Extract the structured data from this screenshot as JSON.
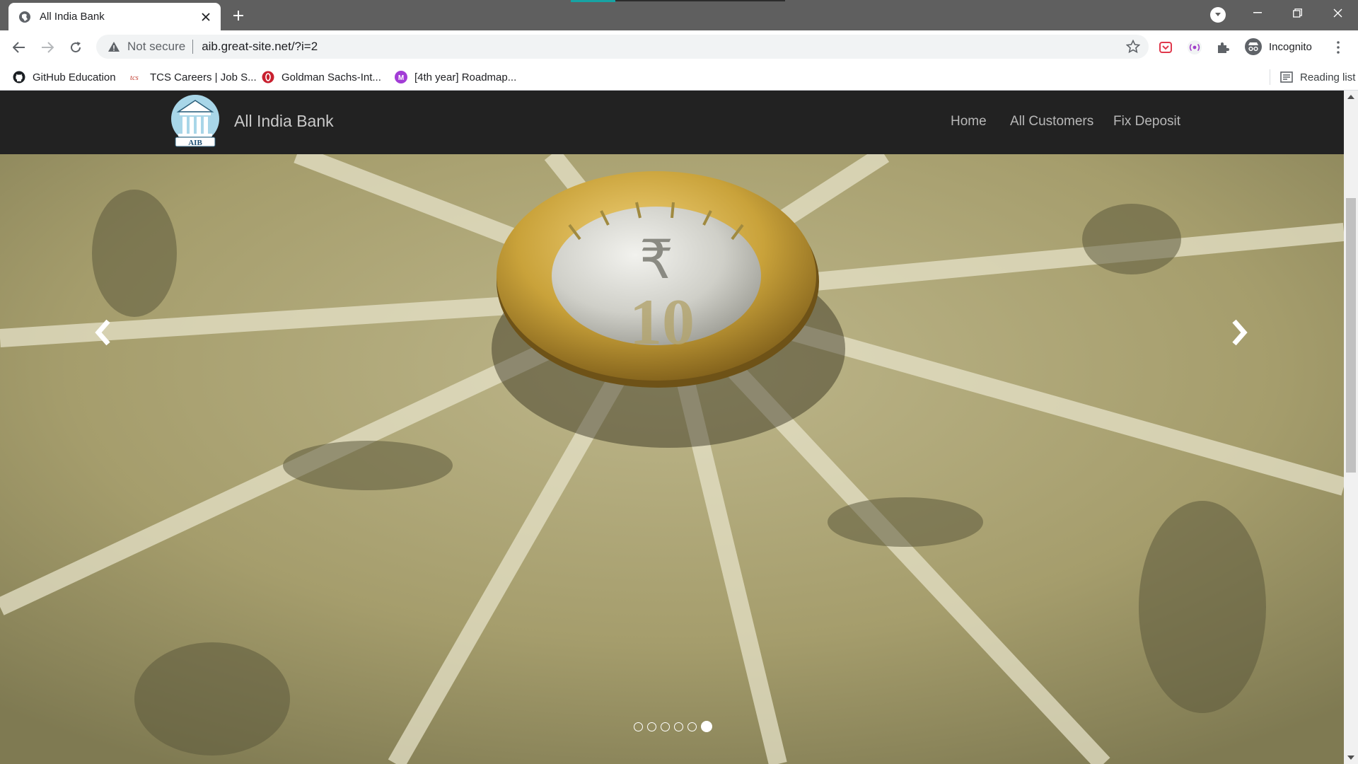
{
  "browser": {
    "tab_title": "All India Bank",
    "omnibox": {
      "security_text": "Not secure",
      "url": "aib.great-site.net/?i=2"
    },
    "profile_label": "Incognito",
    "bookmarks": [
      {
        "label": "GitHub Education",
        "icon": "github-icon"
      },
      {
        "label": "TCS Careers | Job S...",
        "icon": "tcs-icon"
      },
      {
        "label": "Goldman Sachs-Int...",
        "icon": "goldman-sachs-icon"
      },
      {
        "label": "[4th year] Roadmap...",
        "icon": "m-avatar-icon",
        "avatar_letter": "M"
      }
    ],
    "reading_list_label": "Reading list"
  },
  "site": {
    "brand_name": "All India Bank",
    "logo_text": "AIB",
    "nav": [
      {
        "label": "Home"
      },
      {
        "label": "All Customers"
      },
      {
        "label": "Fix Deposit"
      }
    ],
    "carousel": {
      "slide_count": 6,
      "active_slide": 6,
      "slide_image": "rupee-notes-and-10-rupee-coin",
      "coin_symbol": "₹",
      "coin_value": "10"
    }
  },
  "colors": {
    "tabstrip": "#5f5f5f",
    "site_nav_bg": "#222222",
    "nav_link": "#b8b8b8",
    "brand_text": "#c9c9c9",
    "note_base": "#a9a272",
    "coin_gold": "#c9a23a",
    "coin_silver": "#d8d8d2"
  }
}
